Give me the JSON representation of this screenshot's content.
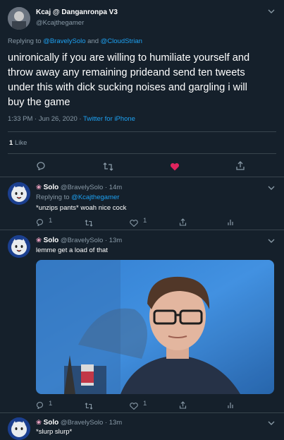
{
  "main": {
    "author_name": "Kcaj @ Danganronpa V3",
    "author_handle": "@Kcajthegamer",
    "replying_prefix": "Replying to",
    "replying_user1": "@BravelySolo",
    "replying_and": "and",
    "replying_user2": "@CloudStrian",
    "text_line1": "unironically if you are willing to humiliate yourself and",
    "text_line2": "throw away any remaining prideand send ten tweets",
    "text_line3": "under this with dick sucking noises and gargling i will",
    "text_line4": "buy the game",
    "time": "1:33 PM · Jun 26, 2020 ·",
    "source": "Twitter for iPhone",
    "likes_count": "1",
    "likes_label": "Like"
  },
  "replies": [
    {
      "name": "Solo",
      "handle_time": "@BravelySolo · 14m",
      "replying_prefix": "Replying to",
      "replying_user": "@Kcajthegamer",
      "text": "*unzips pants* woah nice cock",
      "reply_count": "1",
      "like_count": "1"
    },
    {
      "name": "Solo",
      "handle_time": "@BravelySolo · 13m",
      "text": "lemme get a load of that",
      "reply_count": "1",
      "like_count": "1"
    },
    {
      "name": "Solo",
      "handle_time": "@BravelySolo · 13m",
      "text": "*slurp slurp*"
    }
  ],
  "colors": {
    "background": "#15202b",
    "accent": "#1da1f2",
    "muted": "#8899a6",
    "like_active": "#e0245e",
    "divider": "#38444d"
  },
  "icons": [
    "reply-icon",
    "retweet-icon",
    "heart-icon",
    "share-icon",
    "analytics-icon",
    "chevron-down-icon",
    "flower-icon"
  ]
}
